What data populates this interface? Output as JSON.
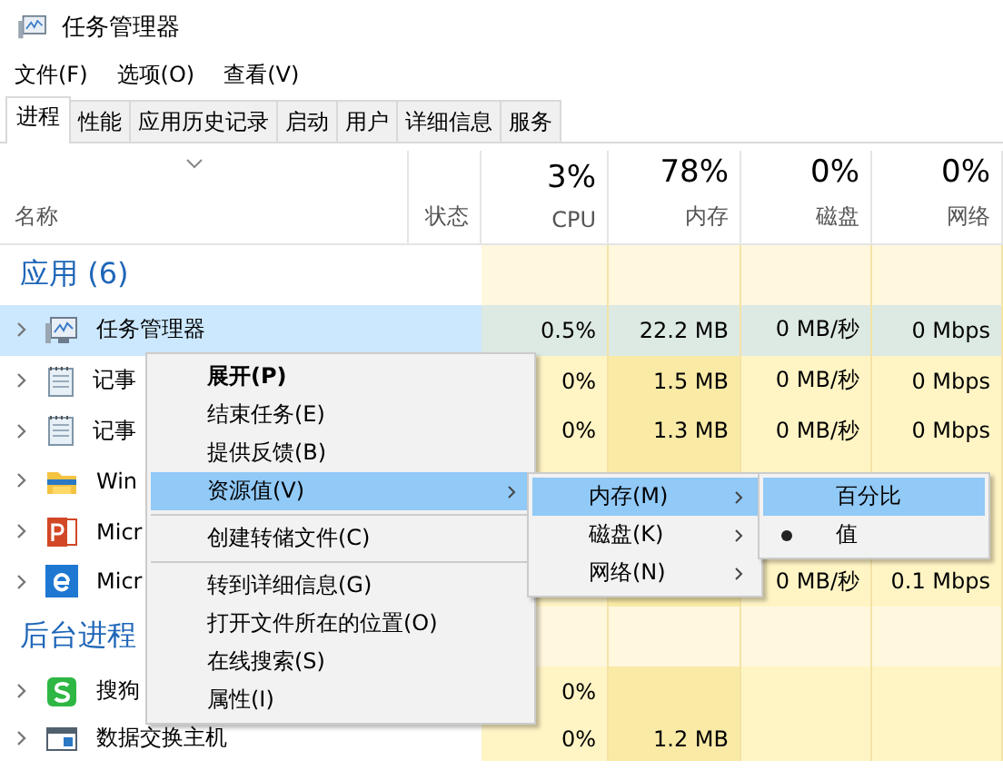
{
  "window": {
    "title": "任务管理器"
  },
  "menu_bar": [
    "文件(F)",
    "选项(O)",
    "查看(V)"
  ],
  "tabs": [
    {
      "label": "进程",
      "selected": true
    },
    {
      "label": "性能",
      "selected": false
    },
    {
      "label": "应用历史记录",
      "selected": false
    },
    {
      "label": "启动",
      "selected": false
    },
    {
      "label": "用户",
      "selected": false
    },
    {
      "label": "详细信息",
      "selected": false
    },
    {
      "label": "服务",
      "selected": false
    }
  ],
  "table": {
    "columns": [
      {
        "label": "名称"
      },
      {
        "label": "状态"
      },
      {
        "label": "CPU",
        "usage": "3%"
      },
      {
        "label": "内存",
        "usage": "78%"
      },
      {
        "label": "磁盘",
        "usage": "0%"
      },
      {
        "label": "网络",
        "usage": "0%"
      }
    ],
    "groups": [
      {
        "title": "应用 (6)",
        "rows": [
          {
            "name": "任务管理器",
            "kind": "taskmgr",
            "selected": true,
            "cells": [
              null,
              "0.5%",
              "22.2 MB",
              "0 MB/秒",
              "0 Mbps"
            ]
          },
          {
            "name": "记事",
            "kind": "notepad",
            "selected": false,
            "cells": [
              null,
              "0%",
              "1.5 MB",
              "0 MB/秒",
              "0 Mbps"
            ]
          },
          {
            "name": "记事",
            "kind": "notepad",
            "selected": false,
            "cells": [
              null,
              "0%",
              "1.3 MB",
              "0 MB/秒",
              "0 Mbps"
            ]
          },
          {
            "name": "Win",
            "kind": "folder",
            "selected": false,
            "cells": [
              null,
              null,
              null,
              null,
              null
            ]
          },
          {
            "name": "Micr",
            "kind": "ppt",
            "selected": false,
            "cells": [
              null,
              null,
              null,
              null,
              null
            ]
          },
          {
            "name": "Micr",
            "kind": "edge",
            "selected": false,
            "cells": [
              null,
              null,
              null,
              "0 MB/秒",
              "0.1 Mbps"
            ]
          }
        ]
      },
      {
        "title": "后台进程",
        "rows": [
          {
            "name": "搜狗",
            "kind": "sogou",
            "selected": false,
            "cells": [
              null,
              "0%",
              null,
              null,
              null
            ]
          },
          {
            "name": "数据交换主机",
            "kind": "app",
            "selected": false,
            "cells": [
              null,
              "0%",
              "1.2 MB",
              null,
              null
            ]
          }
        ]
      }
    ]
  },
  "context_menu": {
    "items": [
      {
        "kind": "item",
        "label": "展开(P)",
        "default": true,
        "highlighted": false,
        "submenu": false
      },
      {
        "kind": "item",
        "label": "结束任务(E)",
        "default": false,
        "highlighted": false,
        "submenu": false
      },
      {
        "kind": "item",
        "label": "提供反馈(B)",
        "default": false,
        "highlighted": false,
        "submenu": false
      },
      {
        "kind": "item",
        "label": "资源值(V)",
        "default": false,
        "highlighted": true,
        "submenu": true
      },
      {
        "kind": "separator"
      },
      {
        "kind": "item",
        "label": "创建转储文件(C)",
        "default": false,
        "highlighted": false,
        "submenu": false
      },
      {
        "kind": "separator"
      },
      {
        "kind": "item",
        "label": "转到详细信息(G)",
        "default": false,
        "highlighted": false,
        "submenu": false
      },
      {
        "kind": "item",
        "label": "打开文件所在的位置(O)",
        "default": false,
        "highlighted": false,
        "submenu": false
      },
      {
        "kind": "item",
        "label": "在线搜索(S)",
        "default": false,
        "highlighted": false,
        "submenu": false
      },
      {
        "kind": "item",
        "label": "属性(I)",
        "default": false,
        "highlighted": false,
        "submenu": false
      }
    ]
  },
  "submenu": {
    "items": [
      {
        "kind": "item",
        "label": "内存(M)",
        "highlighted": true,
        "submenu": true
      },
      {
        "kind": "item",
        "label": "磁盘(K)",
        "highlighted": false,
        "submenu": true
      },
      {
        "kind": "item",
        "label": "网络(N)",
        "highlighted": false,
        "submenu": true
      }
    ]
  },
  "submenu_2": {
    "items": [
      {
        "kind": "radio",
        "label": "百分比",
        "highlighted": true,
        "checked": false
      },
      {
        "kind": "radio",
        "label": "值",
        "highlighted": false,
        "checked": true
      }
    ]
  }
}
